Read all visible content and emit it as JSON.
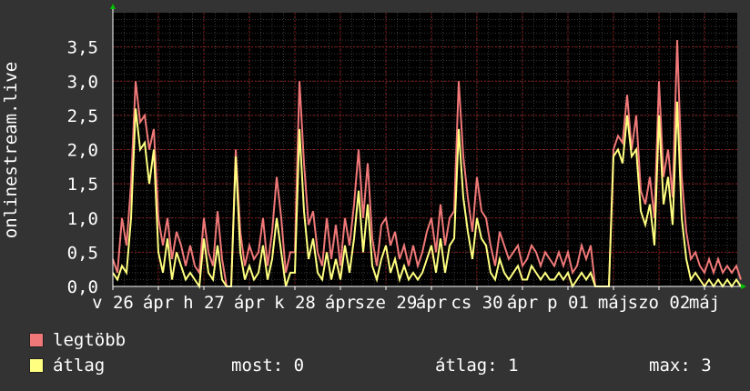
{
  "chart_data": {
    "type": "line",
    "ylabel": "onlinestream.live",
    "ylim": [
      0,
      4
    ],
    "yticks": [
      "0,0",
      "0,5",
      "1,0",
      "1,5",
      "2,0",
      "2,5",
      "3,0",
      "3,5"
    ],
    "ytick_values": [
      0,
      0.5,
      1.0,
      1.5,
      2.0,
      2.5,
      3.0,
      3.5
    ],
    "xticks": [
      {
        "label": "v 26",
        "day": 0
      },
      {
        "label": "ápr",
        "day": 0.5
      },
      {
        "label": "h 27",
        "day": 1
      },
      {
        "label": "ápr",
        "day": 1.5
      },
      {
        "label": "k 28",
        "day": 2
      },
      {
        "label": "ápr",
        "day": 2.5
      },
      {
        "label": "sze 29",
        "day": 3
      },
      {
        "label": "ápr",
        "day": 3.5
      },
      {
        "label": "cs 30",
        "day": 4
      },
      {
        "label": "ápr",
        "day": 4.5
      },
      {
        "label": "p 01",
        "day": 5
      },
      {
        "label": "máj",
        "day": 5.5
      },
      {
        "label": "szo 02",
        "day": 6
      },
      {
        "label": "máj",
        "day": 6.5
      }
    ],
    "xlim_days": [
      0,
      6.95
    ],
    "series": [
      {
        "name": "legtöbb",
        "color": "#f07878",
        "x": [
          0.0,
          0.05,
          0.1,
          0.15,
          0.2,
          0.25,
          0.3,
          0.35,
          0.4,
          0.45,
          0.5,
          0.55,
          0.6,
          0.65,
          0.7,
          0.75,
          0.8,
          0.85,
          0.9,
          0.95,
          1.0,
          1.05,
          1.1,
          1.15,
          1.2,
          1.25,
          1.3,
          1.35,
          1.4,
          1.45,
          1.5,
          1.55,
          1.6,
          1.65,
          1.7,
          1.75,
          1.8,
          1.85,
          1.9,
          1.95,
          2.0,
          2.05,
          2.1,
          2.15,
          2.2,
          2.25,
          2.3,
          2.35,
          2.4,
          2.45,
          2.5,
          2.55,
          2.6,
          2.65,
          2.7,
          2.75,
          2.8,
          2.85,
          2.9,
          2.95,
          3.0,
          3.05,
          3.1,
          3.15,
          3.2,
          3.25,
          3.3,
          3.35,
          3.4,
          3.45,
          3.5,
          3.55,
          3.6,
          3.65,
          3.7,
          3.75,
          3.8,
          3.85,
          3.9,
          3.95,
          4.0,
          4.05,
          4.1,
          4.15,
          4.2,
          4.25,
          4.3,
          4.35,
          4.4,
          4.45,
          4.5,
          4.55,
          4.6,
          4.65,
          4.7,
          4.75,
          4.8,
          4.85,
          4.9,
          4.95,
          5.0,
          5.05,
          5.1,
          5.15,
          5.2,
          5.25,
          5.3,
          5.35,
          5.4,
          5.45,
          5.5,
          5.55,
          5.6,
          5.65,
          5.7,
          5.75,
          5.8,
          5.85,
          5.9,
          5.95,
          6.0,
          6.05,
          6.1,
          6.15,
          6.2,
          6.25,
          6.3,
          6.35,
          6.4,
          6.45,
          6.5,
          6.55,
          6.6,
          6.65,
          6.7,
          6.75,
          6.8,
          6.85,
          6.9
        ],
        "values": [
          0.4,
          0.2,
          1.0,
          0.6,
          1.5,
          3.0,
          2.4,
          2.5,
          2.0,
          2.3,
          1.0,
          0.6,
          1.0,
          0.4,
          0.8,
          0.6,
          0.3,
          0.6,
          0.3,
          0.2,
          1.0,
          0.5,
          0.3,
          1.1,
          0.4,
          0.0,
          0.0,
          2.0,
          0.8,
          0.3,
          0.6,
          0.4,
          0.5,
          1.0,
          0.3,
          0.8,
          1.6,
          1.0,
          0.2,
          0.5,
          0.5,
          3.0,
          1.8,
          0.9,
          1.1,
          0.5,
          0.3,
          1.0,
          0.4,
          0.9,
          0.3,
          1.0,
          0.6,
          1.2,
          2.0,
          1.0,
          1.8,
          0.7,
          0.3,
          0.9,
          1.0,
          0.6,
          0.8,
          0.4,
          0.6,
          0.3,
          0.6,
          0.3,
          0.5,
          0.8,
          1.0,
          0.5,
          1.2,
          0.6,
          1.0,
          1.1,
          3.0,
          1.9,
          1.3,
          0.8,
          1.6,
          1.1,
          1.0,
          0.6,
          0.3,
          0.8,
          0.6,
          0.4,
          0.5,
          0.6,
          0.3,
          0.4,
          0.6,
          0.5,
          0.3,
          0.5,
          0.4,
          0.3,
          0.5,
          0.3,
          0.5,
          0.2,
          0.3,
          0.6,
          0.4,
          0.6,
          0.0,
          0.0,
          0.0,
          0.0,
          2.0,
          2.2,
          2.1,
          2.8,
          2.0,
          2.5,
          1.4,
          1.2,
          1.6,
          1.0,
          3.0,
          1.6,
          2.0,
          1.3,
          3.6,
          1.6,
          0.8,
          0.4,
          0.5,
          0.3,
          0.2,
          0.4,
          0.2,
          0.4,
          0.2,
          0.3,
          0.2,
          0.3,
          0.1
        ]
      },
      {
        "name": "átlag",
        "color": "#ffff80",
        "x": [
          0.0,
          0.05,
          0.1,
          0.15,
          0.2,
          0.25,
          0.3,
          0.35,
          0.4,
          0.45,
          0.5,
          0.55,
          0.6,
          0.65,
          0.7,
          0.75,
          0.8,
          0.85,
          0.9,
          0.95,
          1.0,
          1.05,
          1.1,
          1.15,
          1.2,
          1.25,
          1.3,
          1.35,
          1.4,
          1.45,
          1.5,
          1.55,
          1.6,
          1.65,
          1.7,
          1.75,
          1.8,
          1.85,
          1.9,
          1.95,
          2.0,
          2.05,
          2.1,
          2.15,
          2.2,
          2.25,
          2.3,
          2.35,
          2.4,
          2.45,
          2.5,
          2.55,
          2.6,
          2.65,
          2.7,
          2.75,
          2.8,
          2.85,
          2.9,
          2.95,
          3.0,
          3.05,
          3.1,
          3.15,
          3.2,
          3.25,
          3.3,
          3.35,
          3.4,
          3.45,
          3.5,
          3.55,
          3.6,
          3.65,
          3.7,
          3.75,
          3.8,
          3.85,
          3.9,
          3.95,
          4.0,
          4.05,
          4.1,
          4.15,
          4.2,
          4.25,
          4.3,
          4.35,
          4.4,
          4.45,
          4.5,
          4.55,
          4.6,
          4.65,
          4.7,
          4.75,
          4.8,
          4.85,
          4.9,
          4.95,
          5.0,
          5.05,
          5.1,
          5.15,
          5.2,
          5.25,
          5.3,
          5.35,
          5.4,
          5.45,
          5.5,
          5.55,
          5.6,
          5.65,
          5.7,
          5.75,
          5.8,
          5.85,
          5.9,
          5.95,
          6.0,
          6.05,
          6.1,
          6.15,
          6.2,
          6.25,
          6.3,
          6.35,
          6.4,
          6.45,
          6.5,
          6.55,
          6.6,
          6.65,
          6.7,
          6.75,
          6.8,
          6.85,
          6.9
        ],
        "values": [
          0.2,
          0.1,
          0.3,
          0.2,
          1.0,
          2.6,
          2.0,
          2.1,
          1.5,
          2.0,
          0.5,
          0.2,
          0.7,
          0.1,
          0.5,
          0.3,
          0.1,
          0.2,
          0.1,
          0.0,
          0.7,
          0.2,
          0.1,
          0.6,
          0.1,
          0.0,
          0.0,
          1.9,
          0.5,
          0.1,
          0.3,
          0.1,
          0.2,
          0.6,
          0.1,
          0.4,
          1.0,
          0.5,
          0.0,
          0.2,
          0.2,
          2.3,
          1.1,
          0.4,
          0.7,
          0.2,
          0.1,
          0.5,
          0.1,
          0.4,
          0.1,
          0.6,
          0.2,
          0.7,
          1.4,
          0.5,
          1.2,
          0.3,
          0.1,
          0.4,
          0.6,
          0.2,
          0.4,
          0.1,
          0.3,
          0.1,
          0.2,
          0.1,
          0.2,
          0.4,
          0.6,
          0.2,
          0.7,
          0.2,
          0.6,
          0.7,
          2.3,
          1.3,
          0.8,
          0.4,
          1.0,
          0.7,
          0.6,
          0.2,
          0.1,
          0.4,
          0.2,
          0.1,
          0.2,
          0.3,
          0.1,
          0.1,
          0.3,
          0.2,
          0.1,
          0.2,
          0.1,
          0.1,
          0.2,
          0.1,
          0.2,
          0.0,
          0.1,
          0.2,
          0.1,
          0.2,
          0.0,
          0.0,
          0.0,
          0.0,
          1.9,
          2.0,
          1.8,
          2.5,
          1.9,
          2.0,
          1.1,
          0.9,
          1.2,
          0.6,
          2.5,
          1.2,
          1.6,
          0.9,
          2.7,
          1.0,
          0.4,
          0.1,
          0.2,
          0.1,
          0.0,
          0.1,
          0.0,
          0.1,
          0.0,
          0.1,
          0.0,
          0.1,
          0.0
        ]
      }
    ],
    "grid": true,
    "background": "#000000",
    "grid_color": "#8a1a1a",
    "legend_placement": "bottom-left"
  },
  "legend": [
    {
      "label": "legtöbb",
      "color": "#f07878"
    },
    {
      "label": "átlag",
      "color": "#ffff80"
    }
  ],
  "stats": {
    "most": "most: 0",
    "atlag": "átlag: 1",
    "max": "max: 3"
  },
  "colors": {
    "page_background": "#333333",
    "axis": "#ffffff",
    "arrow": "#00c000"
  }
}
